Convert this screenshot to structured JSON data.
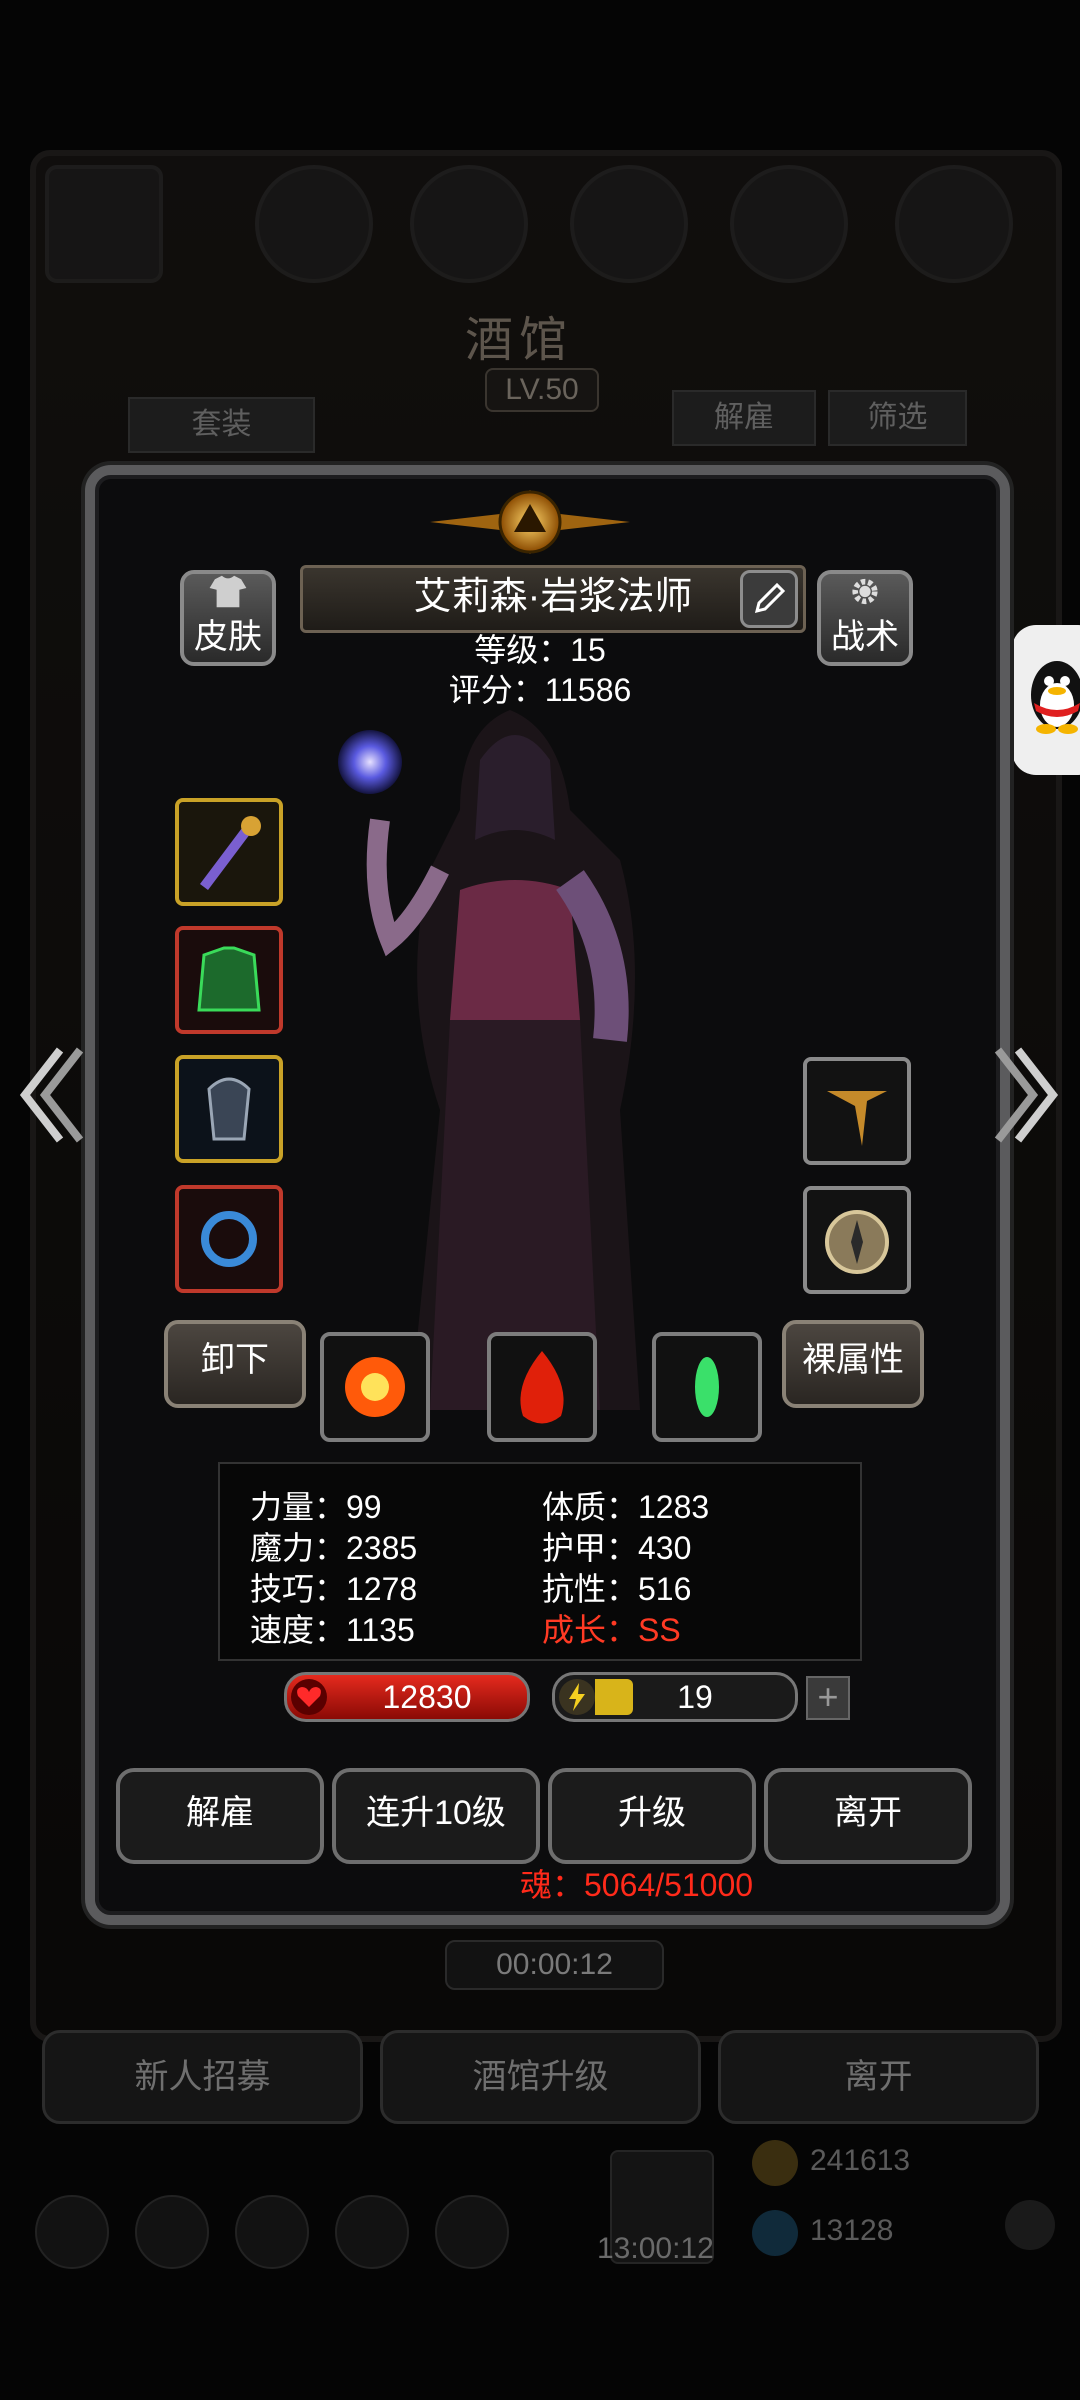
{
  "background": {
    "title": "酒馆",
    "level": "LV.50",
    "tabs": [
      "套装",
      "解雇",
      "筛选"
    ],
    "timer": "00:00:12",
    "bottom_buttons": [
      "新人招募",
      "酒馆升级",
      "离开"
    ],
    "gift_timer": "13:00:12",
    "currency_1": "241613",
    "currency_2": "13128"
  },
  "hero": {
    "name": "艾莉森·岩浆法师",
    "level_line": "等级：15",
    "score_line": "评分：11586",
    "skin_label": "皮肤",
    "tactics_label": "战术",
    "unequip_label": "卸下",
    "naked_attr_label": "裸属性"
  },
  "stats": {
    "strength": "力量：99",
    "magic": "魔力：2385",
    "skill": "技巧：1278",
    "speed": "速度：1135",
    "constitution": "体质：1283",
    "armor": "护甲：430",
    "resistance": "抗性：516",
    "growth": "成长：SS"
  },
  "bars": {
    "hp": "12830",
    "energy": "19",
    "energy_fraction": 0.2
  },
  "actions": {
    "dismiss": "解雇",
    "level10": "连升10级",
    "levelup": "升级",
    "leave": "离开"
  },
  "soul": "魂：5064/51000",
  "colors": {
    "accent_red": "#ff2a1a",
    "frame": "#5b5b5d",
    "gold": "#d8a234"
  }
}
